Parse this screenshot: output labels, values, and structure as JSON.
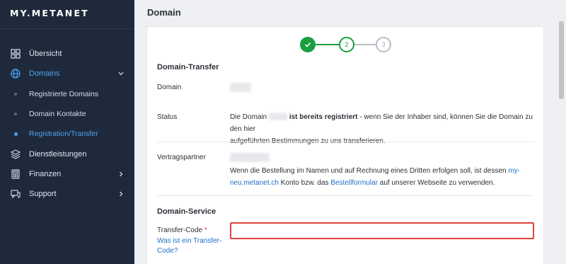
{
  "sidebar": {
    "logo": "MY.METANET",
    "items": [
      {
        "label": "Übersicht",
        "icon": "grid-icon"
      },
      {
        "label": "Domains",
        "icon": "globe-icon",
        "expanded": true
      },
      {
        "label": "Dienstleistungen",
        "icon": "layers-icon"
      },
      {
        "label": "Finanzen",
        "icon": "calculator-icon"
      },
      {
        "label": "Support",
        "icon": "chat-icon"
      }
    ],
    "subitems": [
      {
        "label": "Registrierte Domains"
      },
      {
        "label": "Domain Kontakte"
      },
      {
        "label": "Registration/Transfer",
        "active": true
      }
    ]
  },
  "main": {
    "title": "Domain",
    "stepper": {
      "step1": "check",
      "step2": "2",
      "step3": "3",
      "current_step": 2
    },
    "transfer": {
      "section_title": "Domain-Transfer",
      "domain_label": "Domain",
      "status_label": "Status",
      "status_text_1": "Die Domain",
      "status_bold": "ist bereits registriert",
      "status_text_2": " - wenn Sie der Inhaber sind, können Sie die Domain zu den hier",
      "status_text_3": "aufgeführten Bestimmungen zu uns transferieren.",
      "partner_label": "Vertragspartner",
      "partner_text_1": "Wenn die Bestellung im Namen und auf Rechnung eines Dritten erfolgen soll, ist dessen",
      "partner_link_1a": "my-",
      "partner_link_1b": "neu.metanet.ch",
      "partner_text_2": " Konto bzw. das ",
      "partner_link_2": "Bestellformular",
      "partner_text_3": " auf unserer Webseite zu verwenden."
    },
    "service": {
      "section_title": "Domain-Service",
      "transfer_code_label": "Transfer-Code",
      "required_mark": "*",
      "help_link": "Was ist ein Transfer-Code?",
      "transfer_code_value": ""
    }
  },
  "colors": {
    "sidebar_bg": "#1e2a3b",
    "accent": "#4fa3f3",
    "success": "#1a9e3f",
    "error": "#e0443f",
    "link": "#1e6fc8"
  }
}
